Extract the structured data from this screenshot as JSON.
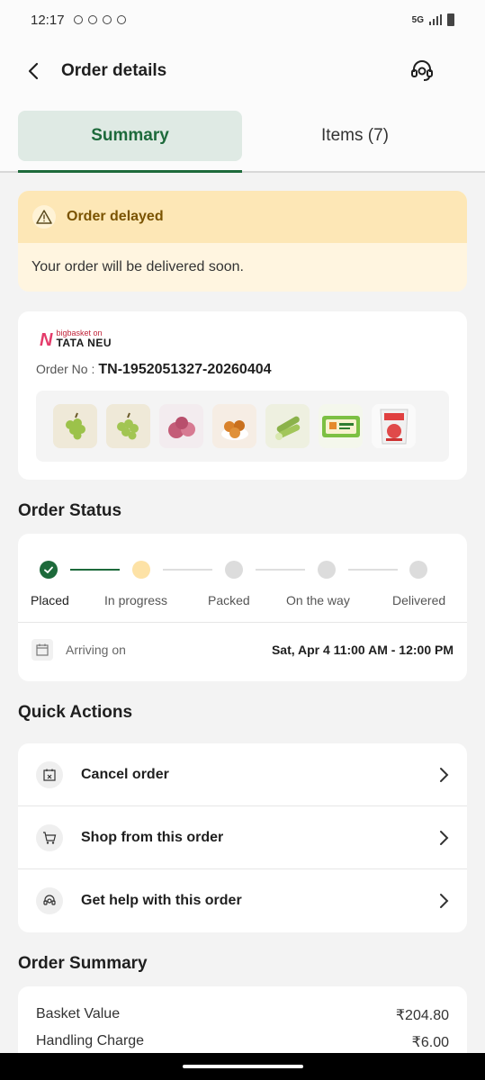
{
  "status_bar": {
    "time": "12:17",
    "network": "5G"
  },
  "header": {
    "title": "Order details"
  },
  "tabs": [
    {
      "label": "Summary",
      "active": true
    },
    {
      "label": "Items (7)",
      "active": false
    }
  ],
  "delay_banner": {
    "title": "Order delayed",
    "message": "Your order will be delivered soon."
  },
  "order": {
    "brand_top": "bigbasket on",
    "brand_bottom": "TATA NEU",
    "order_no_label": "Order No :",
    "order_no": "TN-1952051327-20260404",
    "items": [
      {
        "icon": "grapes-icon"
      },
      {
        "icon": "grapes-icon"
      },
      {
        "icon": "onion-icon"
      },
      {
        "icon": "sweet-icon"
      },
      {
        "icon": "cucumber-icon"
      },
      {
        "icon": "paneer-pack-icon"
      },
      {
        "icon": "pack-icon"
      }
    ]
  },
  "order_status": {
    "title": "Order Status",
    "steps": [
      {
        "label": "Placed",
        "state": "done"
      },
      {
        "label": "In progress",
        "state": "current"
      },
      {
        "label": "Packed",
        "state": "pending"
      },
      {
        "label": "On the way",
        "state": "pending"
      },
      {
        "label": "Delivered",
        "state": "pending"
      }
    ],
    "arriving_label": "Arriving on",
    "arriving_value": "Sat, Apr 4 11:00 AM - 12:00 PM"
  },
  "quick_actions": {
    "title": "Quick Actions",
    "items": [
      {
        "label": "Cancel order",
        "icon": "calendar-cancel-icon"
      },
      {
        "label": "Shop from this order",
        "icon": "cart-icon"
      },
      {
        "label": "Get help with this order",
        "icon": "headset-icon"
      }
    ]
  },
  "order_summary": {
    "title": "Order Summary",
    "rows": [
      {
        "label": "Basket Value",
        "value": "₹204.80"
      },
      {
        "label": "Handling Charge",
        "value": "₹6.00"
      }
    ]
  },
  "colors": {
    "accent": "#1d6a3b",
    "tab_active_bg": "#dfeae4",
    "warning_head": "#fde7b6",
    "warning_body": "#fff5e0",
    "step_current": "#fde2a6",
    "step_pending": "#dcdcdc"
  }
}
